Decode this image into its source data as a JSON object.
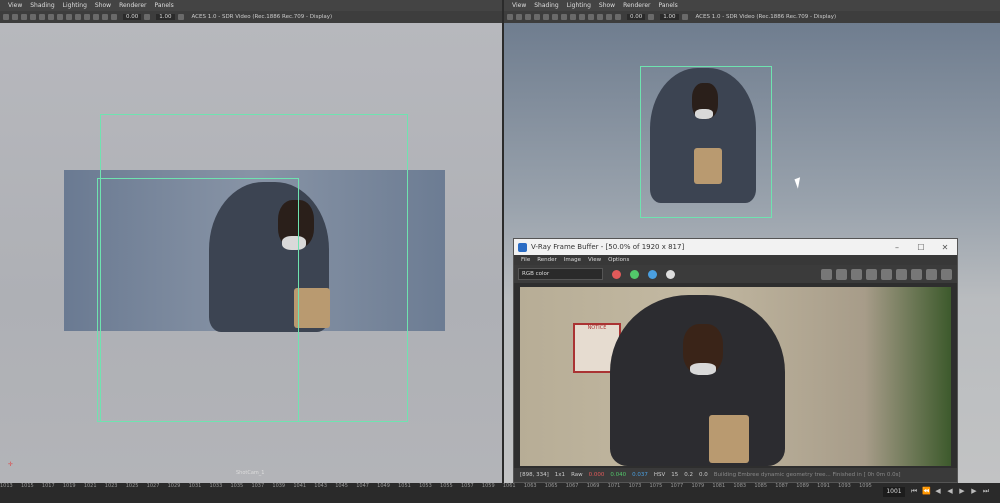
{
  "viewport_menu": [
    "View",
    "Shading",
    "Lighting",
    "Show",
    "Renderer",
    "Panels"
  ],
  "viewport_left": {
    "exposure": "0.00",
    "gamma": "1.00",
    "colorspace": "ACES 1.0 - SDR Video (Rec.1886 Rec.709 - Display)",
    "camera_name": "ShotCam_1"
  },
  "viewport_right": {
    "exposure": "0.00",
    "gamma": "1.00",
    "colorspace": "ACES 1.0 - SDR Video (Rec.1886 Rec.709 - Display)"
  },
  "frame_buffer": {
    "title": "V-Ray Frame Buffer - [50.0% of 1920 x 817]",
    "menu": [
      "File",
      "Render",
      "Image",
      "View",
      "Options"
    ],
    "channel": "RGB color",
    "sign_text": "NOTICE",
    "status": {
      "coords": "[898, 334]",
      "zoom": "1x1",
      "mode": "Raw",
      "r": "0.000",
      "g": "0.040",
      "b": "0.037",
      "space": "HSV",
      "h": "15",
      "s": "0.2",
      "v": "0.0",
      "message": "Building Embree dynamic geometry tree... Finished in [ 0h 0m 0.0s]"
    },
    "colors": {
      "red": "#e25a5a",
      "green": "#52c76a",
      "blue": "#4a9fe0"
    }
  },
  "timeline": {
    "ticks": [
      "1013",
      "1015",
      "1017",
      "1019",
      "1021",
      "1023",
      "1025",
      "1027",
      "1029",
      "1031",
      "1033",
      "1035",
      "1037",
      "1039",
      "1041",
      "1043",
      "1045",
      "1047",
      "1049",
      "1051",
      "1053",
      "1055",
      "1057",
      "1059",
      "1061",
      "1063",
      "1065",
      "1067",
      "1069",
      "1071",
      "1073",
      "1075",
      "1077",
      "1079",
      "1081",
      "1083",
      "1085",
      "1087",
      "1089",
      "1091",
      "1093",
      "1095"
    ],
    "current_frame": "1001"
  },
  "icons": [
    "close-icon",
    "maximize-icon",
    "minimize-icon",
    "save-icon",
    "play-icon",
    "step-back-icon",
    "step-forward-icon"
  ]
}
